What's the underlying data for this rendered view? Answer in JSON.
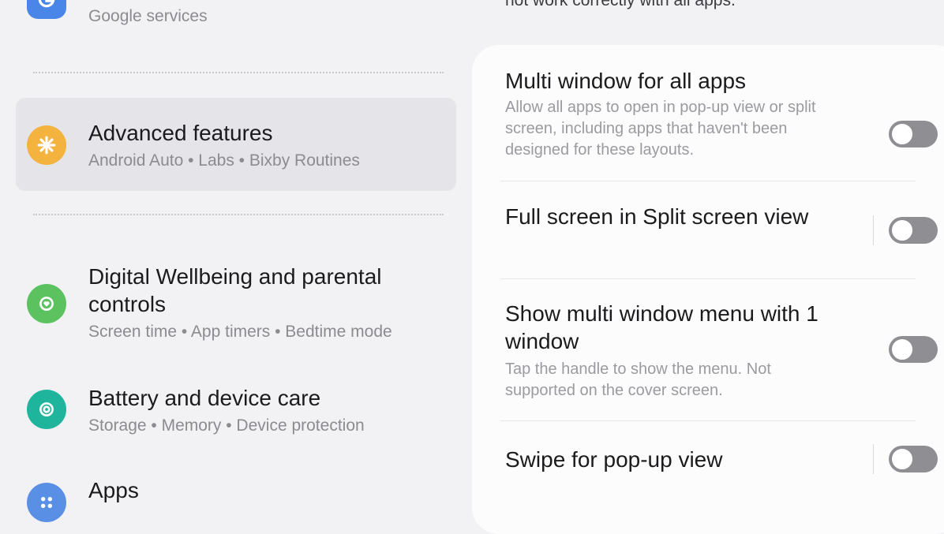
{
  "left_list": {
    "items": [
      {
        "title": "",
        "subtitle": "Google services",
        "icon": "google-icon",
        "color": "#4a86e8"
      },
      {
        "title": "Advanced features",
        "subtitle": "Android Auto • Labs • Bixby Routines",
        "icon": "puzzle-gear-icon",
        "color": "#f4b33e",
        "selected": true
      },
      {
        "title": "Digital Wellbeing and parental controls",
        "subtitle": "Screen time • App timers • Bedtime mode",
        "icon": "wellbeing-icon",
        "color": "#5cc25f"
      },
      {
        "title": "Battery and device care",
        "subtitle": "Storage • Memory • Device protection",
        "icon": "device-care-icon",
        "color": "#1fb59c"
      },
      {
        "title": "Apps",
        "subtitle": "",
        "icon": "apps-icon",
        "color": "#5a8fe6"
      }
    ]
  },
  "right_panel": {
    "top_note": "not work correctly with all apps.",
    "settings": [
      {
        "title": "Multi window for all apps",
        "description": "Allow all apps to open in pop-up view or split screen, including apps that haven't been designed for these layouts.",
        "enabled": false
      },
      {
        "title": "Full screen in Split screen view",
        "description": "",
        "enabled": false
      },
      {
        "title": "Show multi window menu with 1 window",
        "description": "Tap the handle to show the menu. Not supported on the cover screen.",
        "enabled": false
      },
      {
        "title": "Swipe for pop-up view",
        "description": "",
        "enabled": false
      }
    ]
  }
}
